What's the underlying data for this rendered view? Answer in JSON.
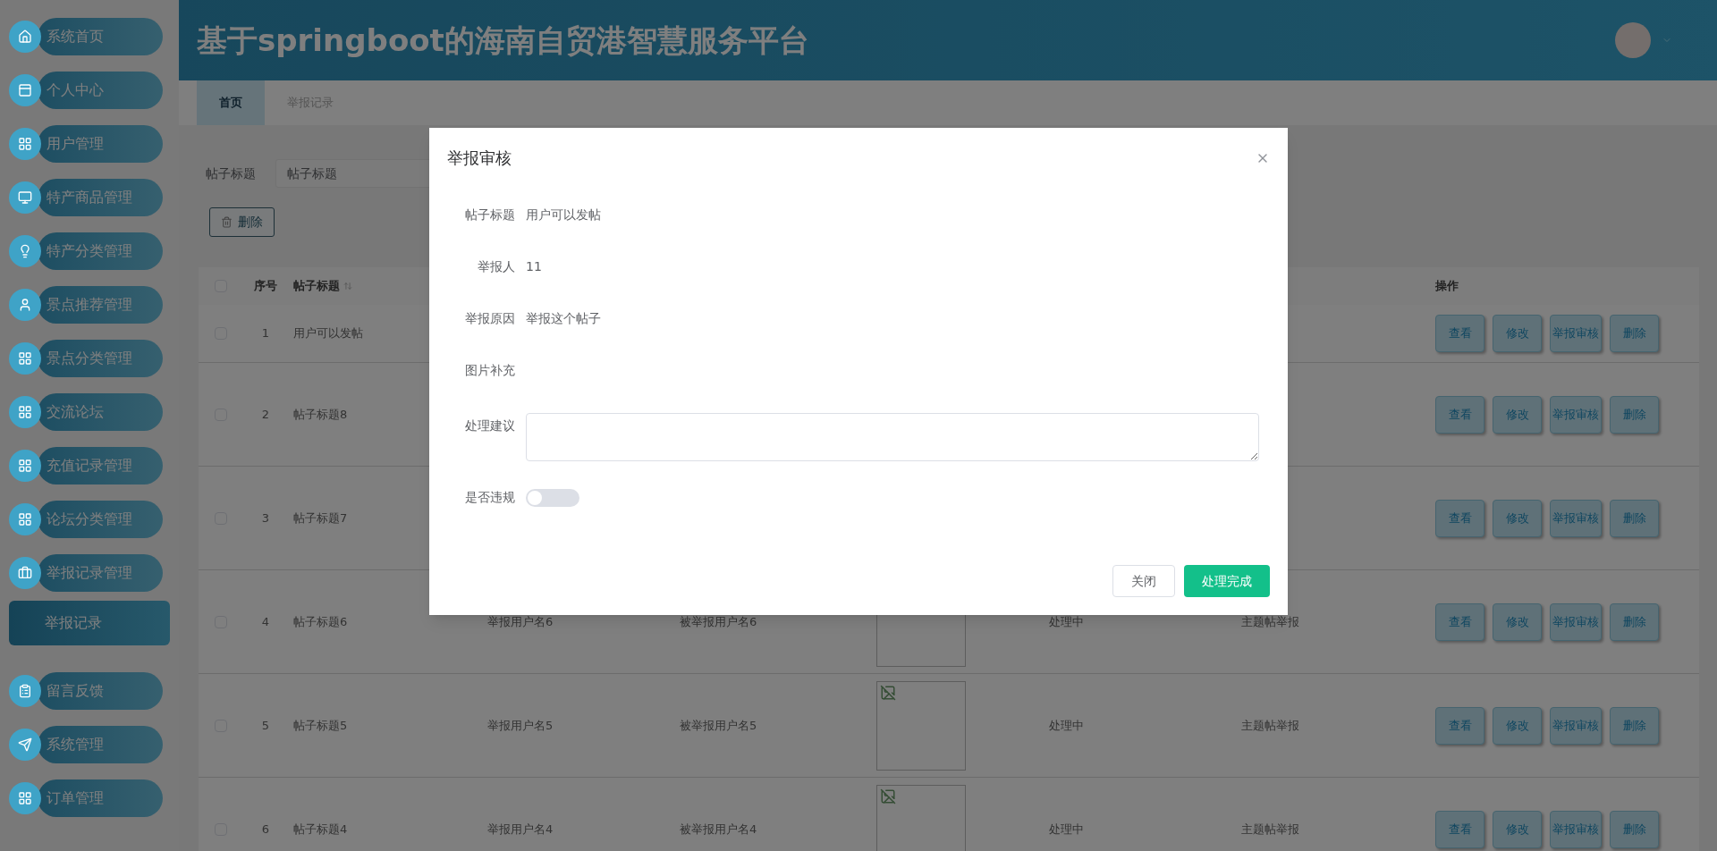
{
  "sidebar": {
    "items": [
      {
        "label": "系统首页",
        "selected": false
      },
      {
        "label": "个人中心",
        "selected": false
      },
      {
        "label": "用户管理",
        "selected": false
      },
      {
        "label": "特产商品管理",
        "selected": false
      },
      {
        "label": "特产分类管理",
        "selected": false
      },
      {
        "label": "景点推荐管理",
        "selected": false
      },
      {
        "label": "景点分类管理",
        "selected": false
      },
      {
        "label": "交流论坛",
        "selected": false
      },
      {
        "label": "充值记录管理",
        "selected": false
      },
      {
        "label": "论坛分类管理",
        "selected": false
      },
      {
        "label": "举报记录管理",
        "selected": false,
        "children": [
          {
            "label": "举报记录",
            "selected": true
          }
        ]
      },
      {
        "label": "留言反馈",
        "selected": false
      },
      {
        "label": "系统管理",
        "selected": false
      },
      {
        "label": "订单管理",
        "selected": false
      }
    ]
  },
  "header": {
    "title": "基于springboot的海南自贸港智慧服务平台"
  },
  "tabs": [
    {
      "label": "首页",
      "selected": true
    },
    {
      "label": "举报记录",
      "selected": false
    }
  ],
  "search": {
    "label": "帖子标题",
    "placeholder": "帖子标题"
  },
  "toolbar": {
    "delete_button": "删除"
  },
  "table": {
    "columns": {
      "index": "序号",
      "title": "帖子标题",
      "actions": "操作"
    },
    "header_checked": false,
    "rows": [
      {
        "checked": false,
        "index": "1",
        "title": "用户可以发帖",
        "actions": [
          "查看",
          "修改",
          "举报审核",
          "删除"
        ]
      },
      {
        "checked": false,
        "index": "2",
        "title": "帖子标题8",
        "actions": [
          "查看",
          "修改",
          "举报审核",
          "删除"
        ]
      },
      {
        "checked": false,
        "index": "3",
        "title": "帖子标题7",
        "actions": [
          "查看",
          "修改",
          "举报审核",
          "删除"
        ]
      },
      {
        "checked": false,
        "index": "4",
        "title": "帖子标题6",
        "reporter": "举报用户名6",
        "reported": "被举报用户名6",
        "status": "处理中",
        "type": "主题帖举报",
        "actions": [
          "查看",
          "修改",
          "举报审核",
          "删除"
        ]
      },
      {
        "checked": false,
        "index": "5",
        "title": "帖子标题5",
        "reporter": "举报用户名5",
        "reported": "被举报用户名5",
        "image": {
          "broken": true
        },
        "status": "处理中",
        "type": "主题帖举报",
        "actions": [
          "查看",
          "修改",
          "举报审核",
          "删除"
        ]
      },
      {
        "checked": false,
        "index": "6",
        "title": "帖子标题4",
        "reporter": "举报用户名4",
        "reported": "被举报用户名4",
        "image": {
          "broken": true
        },
        "status": "处理中",
        "type": "主题帖举报",
        "actions": [
          "查看",
          "修改",
          "举报审核",
          "删除"
        ]
      }
    ]
  },
  "modal": {
    "title": "举报审核",
    "fields": [
      {
        "label": "帖子标题",
        "value": "用户可以发帖"
      },
      {
        "label": "举报人",
        "value": "11"
      },
      {
        "label": "举报原因",
        "value": "举报这个帖子"
      },
      {
        "label": "图片补充"
      }
    ],
    "suggestion": {
      "label": "处理建议"
    },
    "violation": {
      "label": "是否违规",
      "on": false
    },
    "buttons": [
      {
        "label": "关闭",
        "kind": "default"
      },
      {
        "label": "处理完成",
        "kind": "primary"
      }
    ]
  }
}
